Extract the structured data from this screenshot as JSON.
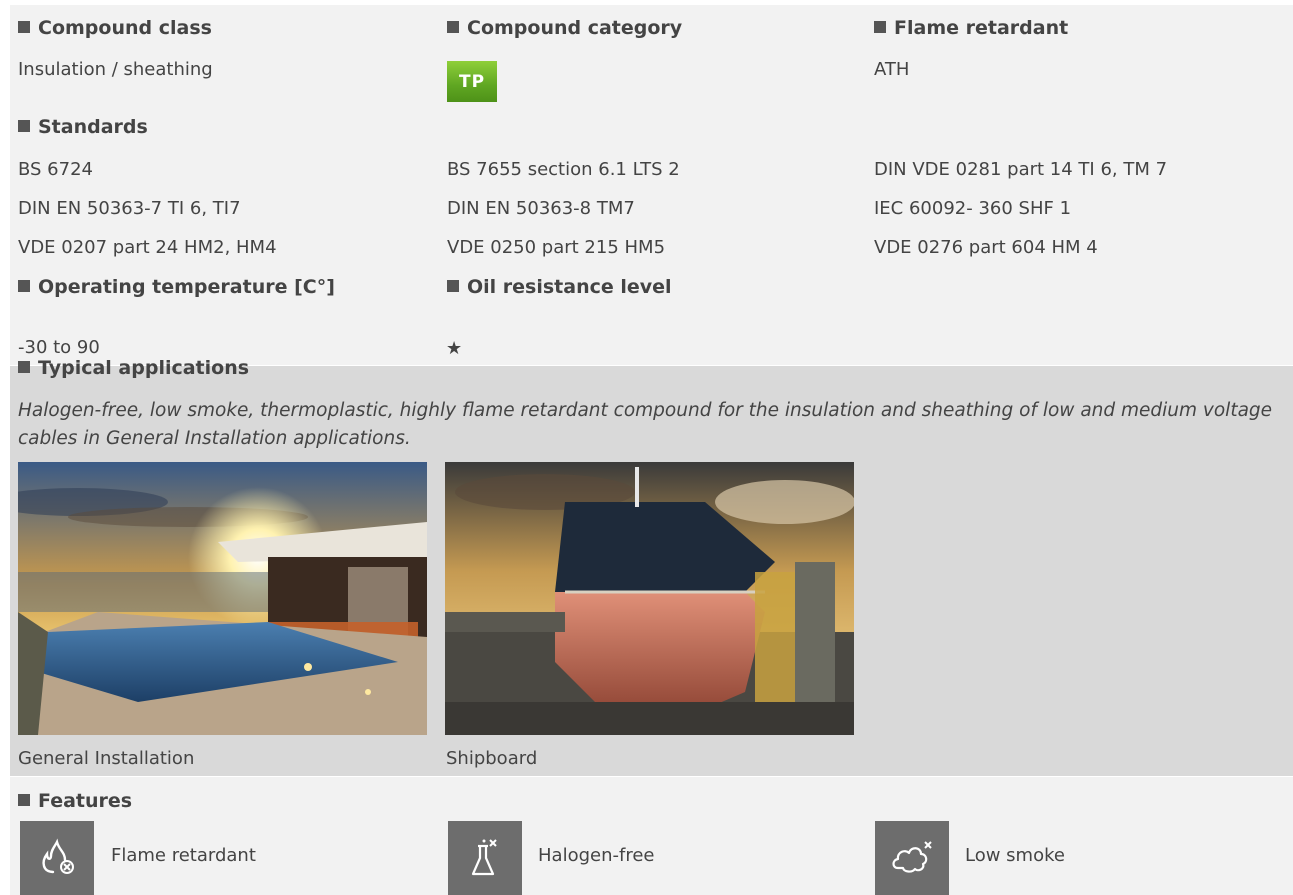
{
  "compound_class": {
    "heading": "Compound class",
    "value": "Insulation / sheathing"
  },
  "compound_category": {
    "heading": "Compound category",
    "badge": "TP",
    "badge_color": "#6bb42a"
  },
  "flame_retardant": {
    "heading": "Flame retardant",
    "value": "ATH"
  },
  "standards": {
    "heading": "Standards",
    "col1": [
      "BS 6724",
      "DIN EN 50363-7 TI 6, TI7",
      "VDE 0207 part 24 HM2, HM4"
    ],
    "col2": [
      "BS 7655 section 6.1 LTS 2",
      "DIN EN 50363-8 TM7",
      "VDE 0250 part 215 HM5"
    ],
    "col3": [
      "DIN VDE 0281 part 14 TI 6, TM 7",
      "IEC 60092- 360 SHF 1",
      "VDE 0276 part 604 HM 4"
    ]
  },
  "operating_temperature": {
    "heading": "Operating temperature [C°]",
    "value": "-30 to 90"
  },
  "oil_resistance": {
    "heading": "Oil resistance level",
    "value": "★"
  },
  "applications": {
    "heading": "Typical applications",
    "description": "Halogen-free, low smoke, thermoplastic, highly flame retardant compound for the insulation and sheathing of low and medium voltage cables in General Installation applications.",
    "items": [
      {
        "label": "General Installation",
        "image": "villa-pool-sunset-photo"
      },
      {
        "label": "Shipboard",
        "image": "ship-drydock-photo"
      }
    ]
  },
  "features": {
    "heading": "Features",
    "items": [
      {
        "label": "Flame retardant",
        "icon": "flame-cross-icon"
      },
      {
        "label": "Halogen-free",
        "icon": "flask-cross-icon"
      },
      {
        "label": "Low smoke",
        "icon": "cloud-cross-icon"
      }
    ]
  }
}
